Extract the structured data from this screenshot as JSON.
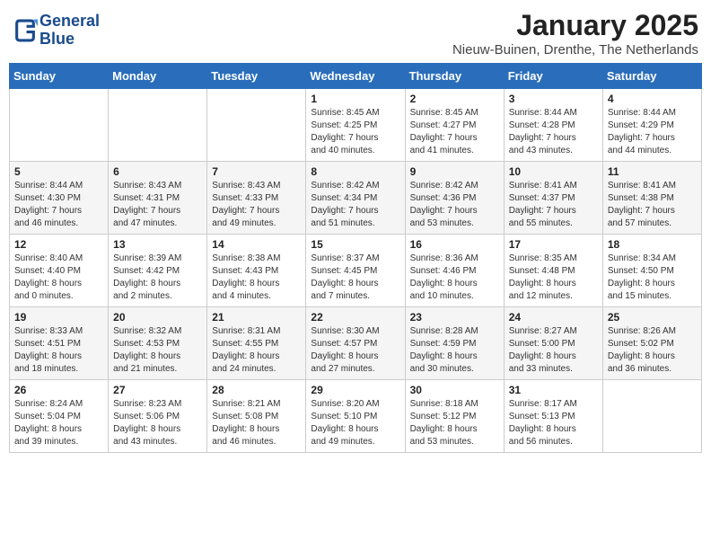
{
  "logo": {
    "name1": "General",
    "name2": "Blue"
  },
  "title": "January 2025",
  "subtitle": "Nieuw-Buinen, Drenthe, The Netherlands",
  "weekdays": [
    "Sunday",
    "Monday",
    "Tuesday",
    "Wednesday",
    "Thursday",
    "Friday",
    "Saturday"
  ],
  "weeks": [
    [
      {
        "day": "",
        "info": ""
      },
      {
        "day": "",
        "info": ""
      },
      {
        "day": "",
        "info": ""
      },
      {
        "day": "1",
        "info": "Sunrise: 8:45 AM\nSunset: 4:25 PM\nDaylight: 7 hours\nand 40 minutes."
      },
      {
        "day": "2",
        "info": "Sunrise: 8:45 AM\nSunset: 4:27 PM\nDaylight: 7 hours\nand 41 minutes."
      },
      {
        "day": "3",
        "info": "Sunrise: 8:44 AM\nSunset: 4:28 PM\nDaylight: 7 hours\nand 43 minutes."
      },
      {
        "day": "4",
        "info": "Sunrise: 8:44 AM\nSunset: 4:29 PM\nDaylight: 7 hours\nand 44 minutes."
      }
    ],
    [
      {
        "day": "5",
        "info": "Sunrise: 8:44 AM\nSunset: 4:30 PM\nDaylight: 7 hours\nand 46 minutes."
      },
      {
        "day": "6",
        "info": "Sunrise: 8:43 AM\nSunset: 4:31 PM\nDaylight: 7 hours\nand 47 minutes."
      },
      {
        "day": "7",
        "info": "Sunrise: 8:43 AM\nSunset: 4:33 PM\nDaylight: 7 hours\nand 49 minutes."
      },
      {
        "day": "8",
        "info": "Sunrise: 8:42 AM\nSunset: 4:34 PM\nDaylight: 7 hours\nand 51 minutes."
      },
      {
        "day": "9",
        "info": "Sunrise: 8:42 AM\nSunset: 4:36 PM\nDaylight: 7 hours\nand 53 minutes."
      },
      {
        "day": "10",
        "info": "Sunrise: 8:41 AM\nSunset: 4:37 PM\nDaylight: 7 hours\nand 55 minutes."
      },
      {
        "day": "11",
        "info": "Sunrise: 8:41 AM\nSunset: 4:38 PM\nDaylight: 7 hours\nand 57 minutes."
      }
    ],
    [
      {
        "day": "12",
        "info": "Sunrise: 8:40 AM\nSunset: 4:40 PM\nDaylight: 8 hours\nand 0 minutes."
      },
      {
        "day": "13",
        "info": "Sunrise: 8:39 AM\nSunset: 4:42 PM\nDaylight: 8 hours\nand 2 minutes."
      },
      {
        "day": "14",
        "info": "Sunrise: 8:38 AM\nSunset: 4:43 PM\nDaylight: 8 hours\nand 4 minutes."
      },
      {
        "day": "15",
        "info": "Sunrise: 8:37 AM\nSunset: 4:45 PM\nDaylight: 8 hours\nand 7 minutes."
      },
      {
        "day": "16",
        "info": "Sunrise: 8:36 AM\nSunset: 4:46 PM\nDaylight: 8 hours\nand 10 minutes."
      },
      {
        "day": "17",
        "info": "Sunrise: 8:35 AM\nSunset: 4:48 PM\nDaylight: 8 hours\nand 12 minutes."
      },
      {
        "day": "18",
        "info": "Sunrise: 8:34 AM\nSunset: 4:50 PM\nDaylight: 8 hours\nand 15 minutes."
      }
    ],
    [
      {
        "day": "19",
        "info": "Sunrise: 8:33 AM\nSunset: 4:51 PM\nDaylight: 8 hours\nand 18 minutes."
      },
      {
        "day": "20",
        "info": "Sunrise: 8:32 AM\nSunset: 4:53 PM\nDaylight: 8 hours\nand 21 minutes."
      },
      {
        "day": "21",
        "info": "Sunrise: 8:31 AM\nSunset: 4:55 PM\nDaylight: 8 hours\nand 24 minutes."
      },
      {
        "day": "22",
        "info": "Sunrise: 8:30 AM\nSunset: 4:57 PM\nDaylight: 8 hours\nand 27 minutes."
      },
      {
        "day": "23",
        "info": "Sunrise: 8:28 AM\nSunset: 4:59 PM\nDaylight: 8 hours\nand 30 minutes."
      },
      {
        "day": "24",
        "info": "Sunrise: 8:27 AM\nSunset: 5:00 PM\nDaylight: 8 hours\nand 33 minutes."
      },
      {
        "day": "25",
        "info": "Sunrise: 8:26 AM\nSunset: 5:02 PM\nDaylight: 8 hours\nand 36 minutes."
      }
    ],
    [
      {
        "day": "26",
        "info": "Sunrise: 8:24 AM\nSunset: 5:04 PM\nDaylight: 8 hours\nand 39 minutes."
      },
      {
        "day": "27",
        "info": "Sunrise: 8:23 AM\nSunset: 5:06 PM\nDaylight: 8 hours\nand 43 minutes."
      },
      {
        "day": "28",
        "info": "Sunrise: 8:21 AM\nSunset: 5:08 PM\nDaylight: 8 hours\nand 46 minutes."
      },
      {
        "day": "29",
        "info": "Sunrise: 8:20 AM\nSunset: 5:10 PM\nDaylight: 8 hours\nand 49 minutes."
      },
      {
        "day": "30",
        "info": "Sunrise: 8:18 AM\nSunset: 5:12 PM\nDaylight: 8 hours\nand 53 minutes."
      },
      {
        "day": "31",
        "info": "Sunrise: 8:17 AM\nSunset: 5:13 PM\nDaylight: 8 hours\nand 56 minutes."
      },
      {
        "day": "",
        "info": ""
      }
    ]
  ]
}
